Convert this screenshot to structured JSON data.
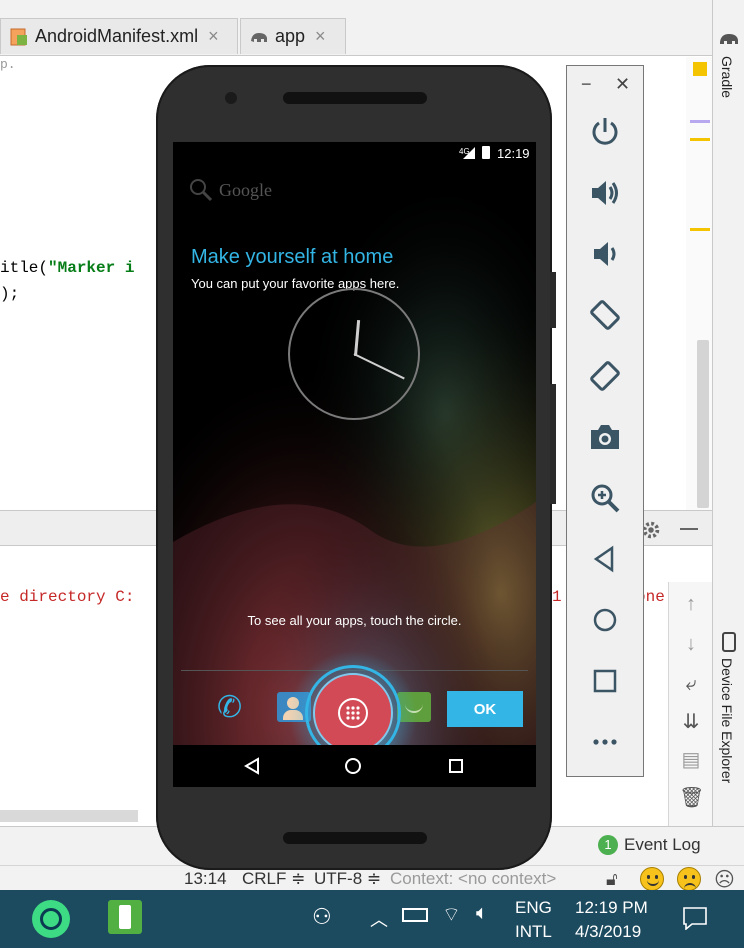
{
  "ide": {
    "tabs": [
      {
        "label": "AndroidManifest.xml",
        "close": "×"
      },
      {
        "label": "app",
        "close": "×"
      }
    ],
    "editor": {
      "line_marker": "p.",
      "code_line1_prefix": "itle(",
      "code_line1_string": "\"Marker i",
      "code_line2": ");"
    },
    "console": {
      "text_left": "e directory C:",
      "text_right_a": "1",
      "text_right_b": "one"
    },
    "right_tools": {
      "gradle": "Gradle",
      "device_file_explorer": "Device File Explorer"
    },
    "event_log": {
      "badge": "1",
      "label": "Event Log"
    },
    "statusbar": {
      "position": "13:14",
      "line_sep": "CRLF ≑",
      "encoding": "UTF-8 ≑",
      "context": "Context: <no context>"
    }
  },
  "emulator_toolbar": {
    "minimize": "−",
    "close": "✕",
    "buttons": [
      "power-icon",
      "volume-up-icon",
      "volume-down-icon",
      "rotate-left-icon",
      "rotate-right-icon",
      "camera-icon",
      "zoom-icon",
      "back-icon",
      "home-icon",
      "overview-icon",
      "more-icon"
    ]
  },
  "phone": {
    "status_time": "12:19",
    "status_network": "4G",
    "search_placeholder": "Google",
    "welcome_title": "Make yourself at home",
    "welcome_subtitle": "You can put your favorite apps here.",
    "hint": "To see all your apps, touch the circle.",
    "ok_label": "OK",
    "accent": "#33b5e5"
  },
  "taskbar": {
    "language_top": "ENG",
    "language_bottom": "INTL",
    "time": "12:19 PM",
    "date": "4/3/2019"
  }
}
